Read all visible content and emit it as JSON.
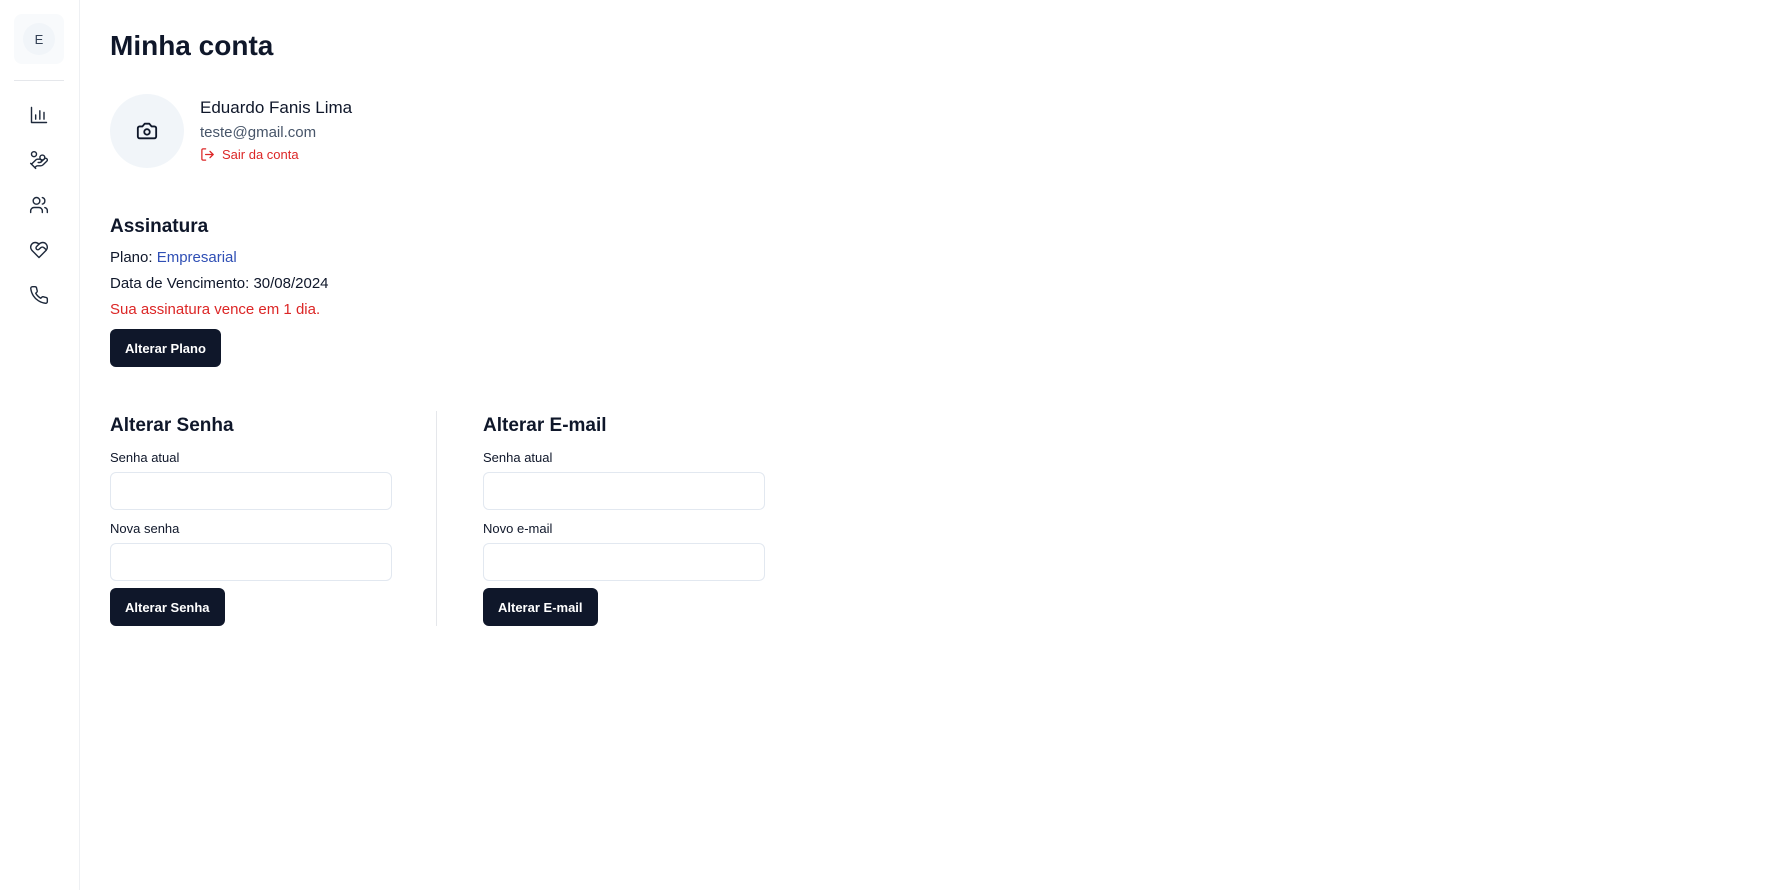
{
  "sidebar": {
    "avatar_initial": "E",
    "nav": [
      {
        "icon": "bar-chart-icon"
      },
      {
        "icon": "hand-coins-icon"
      },
      {
        "icon": "users-icon"
      },
      {
        "icon": "heart-handshake-icon"
      },
      {
        "icon": "phone-icon"
      }
    ]
  },
  "header": {
    "title": "Minha conta"
  },
  "profile": {
    "name": "Eduardo Fanis Lima",
    "email": "teste@gmail.com",
    "logout_label": "Sair da conta"
  },
  "subscription": {
    "title": "Assinatura",
    "plan_label": "Plano: ",
    "plan_value": "Empresarial",
    "due_label": "Data de Vencimento: ",
    "due_value": "30/08/2024",
    "warning": "Sua assinatura vence em 1 dia.",
    "change_plan_button": "Alterar Plano"
  },
  "change_password": {
    "title": "Alterar Senha",
    "current_label": "Senha atual",
    "current_value": "",
    "new_label": "Nova senha",
    "new_value": "",
    "button": "Alterar Senha"
  },
  "change_email": {
    "title": "Alterar E-mail",
    "current_label": "Senha atual",
    "current_value": "",
    "new_label": "Novo e-mail",
    "new_value": "",
    "button": "Alterar E-mail"
  },
  "colors": {
    "primary": "#0f172a",
    "danger": "#dc2626",
    "link": "#2f4fb5"
  }
}
